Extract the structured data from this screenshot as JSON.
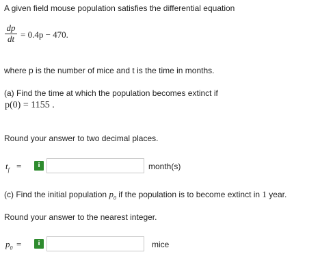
{
  "intro": "A given field mouse population satisfies the differential equation",
  "equation": {
    "numerator": "dp",
    "denominator": "dt",
    "rhs": "= 0.4p − 470."
  },
  "where_text": "where p is the number of mice and t is the time in months.",
  "part_a": {
    "prompt": "(a) Find the time at which the population becomes extinct if",
    "condition": "p(0)  =  1155  .",
    "round_text": "Round your answer to two decimal places.",
    "var_label": "t",
    "var_sub": "f",
    "equals": "=",
    "info_glyph": "i",
    "unit": "month(s)"
  },
  "part_b": {
    "prompt_before": "(c) Find the initial population",
    "var": "p",
    "var_sub": "0",
    "prompt_after": "if the population is to become extinct in",
    "number": "1",
    "prompt_end": "year.",
    "round_text": "Round your answer to the nearest integer.",
    "var_label": "p",
    "var_label_sub": "0",
    "equals": "=",
    "info_glyph": "i",
    "unit": "mice"
  }
}
